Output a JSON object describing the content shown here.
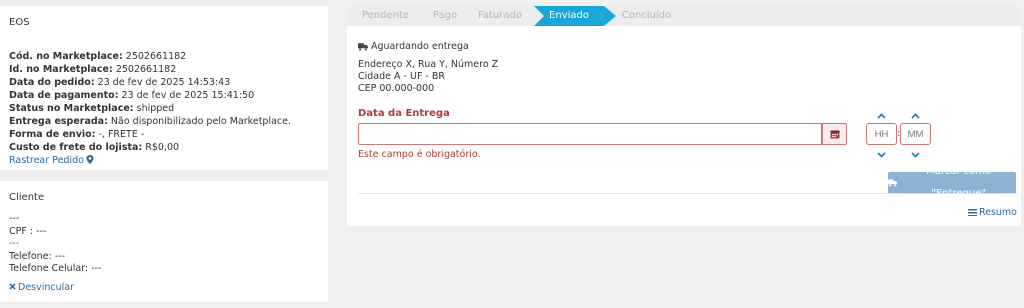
{
  "order": {
    "title": "EOS",
    "fields": [
      {
        "label": "Cód. no Marketplace:",
        "value": " 2502661182"
      },
      {
        "label": "Id. no Marketplace:",
        "value": " 2502661182"
      },
      {
        "label": "Data do pedido:",
        "value": " 23 de fev de 2025 14:53:43"
      },
      {
        "label": "Data de pagamento:",
        "value": " 23 de fev de 2025 15:41:50"
      },
      {
        "label": "Status no Marketplace:",
        "value": " shipped"
      },
      {
        "label": "Entrega esperada:",
        "value": " Não disponibilizado pelo Marketplace."
      },
      {
        "label": "Forma de envio:",
        "value": " -, FRETE -"
      },
      {
        "label": "Custo de frete do lojista:",
        "value": " R$0,00"
      }
    ],
    "track_link": "Rastrear Pedido",
    "track_icon": "map-marker-icon"
  },
  "client": {
    "title": "Cliente",
    "rows": [
      "---",
      "CPF : ---",
      "---",
      "Telefone: ---",
      "Telefone Celular: ---"
    ],
    "unlink_label": "Desvincular",
    "unlink_icon": "close-icon"
  },
  "steps": [
    {
      "label": "Pendente",
      "active": false
    },
    {
      "label": "Pago",
      "active": false
    },
    {
      "label": "Faturado",
      "active": false
    },
    {
      "label": "Enviado",
      "active": true
    },
    {
      "label": "Concluído",
      "active": false
    }
  ],
  "shipment": {
    "status": "Aguardando entrega",
    "address_lines": [
      "Endereço X, Rua Y, Número Z",
      "Cidade A - UF - BR",
      "CEP 00.000-000"
    ],
    "date_label": "Data da Entrega",
    "date_value": "",
    "date_error": "Este campo é obrigatório.",
    "hour_placeholder": "HH",
    "minute_placeholder": "MM",
    "time_separator": ":",
    "deliver_button": "Marcar como \"Entregue\"",
    "summary_link": "Resumo"
  },
  "colors": {
    "active_step": "#1aa6d9",
    "error": "#b13b3b",
    "link": "#2c6aa0",
    "button": "#8db2d4"
  }
}
